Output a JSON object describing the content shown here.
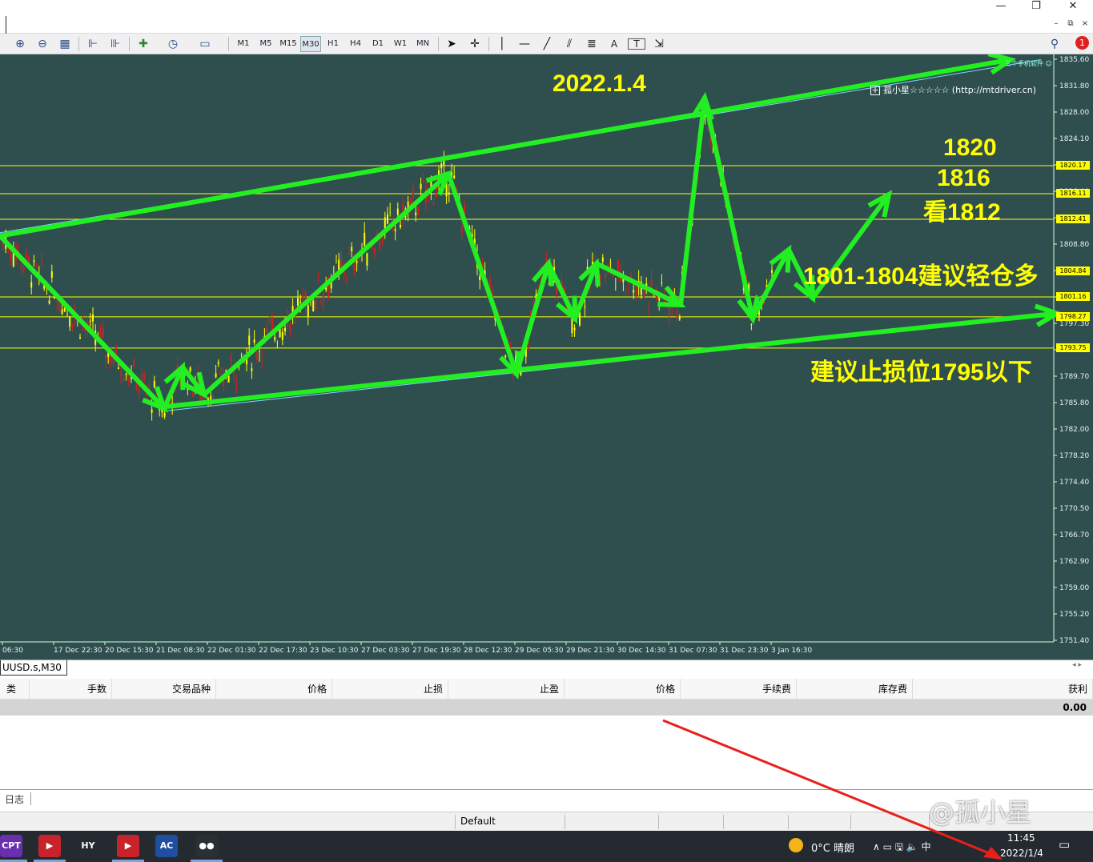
{
  "window": {
    "minimize": "—",
    "restore": "❐",
    "close": "✕",
    "mdi_minimize": "–",
    "mdi_restore": "⧉",
    "mdi_close": "×"
  },
  "toolbar": {
    "timeframes": [
      "M1",
      "M5",
      "M15",
      "M30",
      "H1",
      "H4",
      "D1",
      "W1",
      "MN"
    ],
    "active_timeframe": "M30",
    "text_tool": "A",
    "text_label_tool": "T",
    "notification_count": "1"
  },
  "chart": {
    "symbol_tab": "UUSD.s,M30",
    "watermark_top": "三个手机软件 ☺",
    "watermark_plus": "+",
    "watermark": "孤小星☆☆☆☆☆ (http://mtdriver.cn)",
    "colors": {
      "background": "#2f4f4f",
      "hline": "#ffff00",
      "arrow": "#22ee22",
      "bull": "#ffff00",
      "bear": "#cc2222",
      "channel": "#7fd8ff"
    },
    "price_axis": [
      "1835.60",
      "1831.80",
      "1828.00",
      "1824.10",
      "1820.30",
      "1816.40",
      "1812.60",
      "1808.80",
      "1805.00",
      "1801.10",
      "1797.30",
      "1793.50",
      "1789.70",
      "1785.80",
      "1782.00",
      "1778.20",
      "1774.40",
      "1770.50",
      "1766.70",
      "1762.90",
      "1759.00",
      "1755.20",
      "1751.40"
    ],
    "price_tags": [
      {
        "label": "1820.17",
        "price": 1820.17
      },
      {
        "label": "1816.11",
        "price": 1816.11
      },
      {
        "label": "1812.41",
        "price": 1812.41
      },
      {
        "label": "1804.84",
        "price": 1804.84
      },
      {
        "label": "1801.16",
        "price": 1801.16
      },
      {
        "label": "1798.27",
        "price": 1798.27
      },
      {
        "label": "1793.75",
        "price": 1793.75
      }
    ],
    "time_axis": [
      "06:30",
      "17 Dec 22:30",
      "20 Dec 15:30",
      "21 Dec 08:30",
      "22 Dec 01:30",
      "22 Dec 17:30",
      "23 Dec 10:30",
      "27 Dec 03:30",
      "27 Dec 19:30",
      "28 Dec 12:30",
      "29 Dec 05:30",
      "29 Dec 21:30",
      "30 Dec 14:30",
      "31 Dec 07:30",
      "31 Dec 23:30",
      "3 Jan 16:30"
    ],
    "annotations": {
      "date": "2022.1.4",
      "target_1820": "1820",
      "target_1816": "1816",
      "target_1812": "看1812",
      "buy_zone": "1801-1804建议轻仓多",
      "stop_loss": "建议止损位1795以下"
    }
  },
  "chart_data": {
    "type": "candlestick",
    "y_axis_range": [
      1751.4,
      1835.6
    ],
    "hlines": [
      1820.17,
      1816.11,
      1812.41,
      1801.16,
      1798.27,
      1793.75
    ],
    "path_prices": [
      1810,
      1785,
      1791,
      1787,
      1819,
      1790,
      1806,
      1798,
      1806,
      1800,
      1830,
      1798,
      1808,
      1801,
      1816
    ],
    "channel_upper": [
      1810,
      1836
    ],
    "channel_lower": [
      1785,
      1799
    ]
  },
  "terminal": {
    "columns": [
      "类型",
      "手数",
      "交易品种",
      "价格",
      "止损",
      "止盈",
      "价格",
      "手续费",
      "库存费",
      "获利"
    ],
    "total_profit": "0.00",
    "journal_tab": "日志"
  },
  "status": {
    "profile": "Default"
  },
  "taskbar": {
    "apps": [
      {
        "label": "CPT",
        "color": "#6a2fb0"
      },
      {
        "label": "▶",
        "color": "#c8232b"
      },
      {
        "label": "HY",
        "color": "#252a30"
      },
      {
        "label": "▶",
        "color": "#c8232b"
      },
      {
        "label": "AC",
        "color": "#1e4fa0"
      },
      {
        "label": "●●",
        "color": "#2a2f35"
      }
    ],
    "weather": "0°C  晴朗",
    "time": "11:45",
    "date": "2022/1/4",
    "tray_icons": "∧ ▭ 🖫 🔈 中"
  },
  "overlay_watermark": "@孤小星"
}
